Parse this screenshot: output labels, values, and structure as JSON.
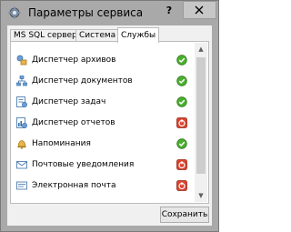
{
  "window": {
    "title": "Параметры сервиса",
    "help_label": "?",
    "close_label": "✕"
  },
  "tabs": [
    {
      "label": "MS SQL сервер",
      "active": false
    },
    {
      "label": "Система",
      "active": false
    },
    {
      "label": "Службы",
      "active": true
    }
  ],
  "services": [
    {
      "label": "Диспетчер архивов",
      "icon": "archive-dispatcher-icon",
      "status": "on"
    },
    {
      "label": "Диспетчер документов",
      "icon": "document-dispatcher-icon",
      "status": "on"
    },
    {
      "label": "Диспетчер задач",
      "icon": "task-dispatcher-icon",
      "status": "on"
    },
    {
      "label": "Диспетчер отчетов",
      "icon": "report-dispatcher-icon",
      "status": "off"
    },
    {
      "label": "Напоминания",
      "icon": "bell-icon",
      "status": "on"
    },
    {
      "label": "Почтовые уведомления",
      "icon": "mail-notification-icon",
      "status": "off"
    },
    {
      "label": "Электронная почта",
      "icon": "email-icon",
      "status": "off"
    }
  ],
  "footer": {
    "save_label": "Сохранить"
  },
  "colors": {
    "status_on": "#4caf2f",
    "status_off": "#d9432f"
  }
}
